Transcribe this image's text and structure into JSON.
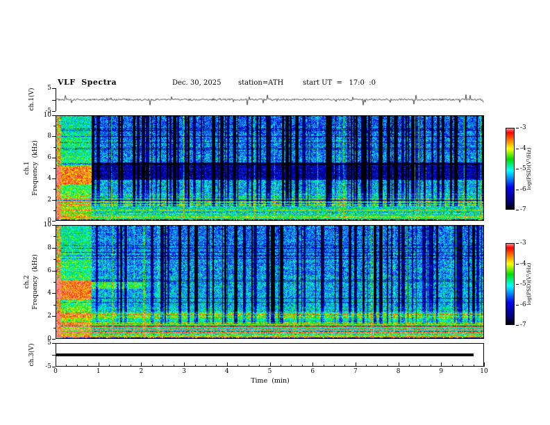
{
  "page": {
    "background": "#ffffff"
  },
  "header": {
    "title": "VLF  Spectra",
    "date": "Dec. 30, 2025",
    "station": "station=ATH",
    "start_ut": "start UT  =   17:0  :0"
  },
  "axes": {
    "time_label": "Time  (min)",
    "time_ticks": [
      0,
      1,
      2,
      3,
      4,
      5,
      6,
      7,
      8,
      9,
      10
    ],
    "freq_ticks": [
      0,
      2,
      4,
      6,
      8,
      10
    ],
    "freq_minor_ticks": [
      1,
      3,
      5,
      7,
      9
    ],
    "volt_ticks": [
      5,
      0,
      -5
    ],
    "volt_labeled": [
      5,
      -5
    ]
  },
  "panels": {
    "ch1_wave": {
      "ylabel": "ch.1(V)",
      "ymin": -5,
      "ymax": 5
    },
    "ch1_spec": {
      "ylabel_channel": "ch.1",
      "ylabel_axis": "Frequency  (kHz)"
    },
    "ch2_spec": {
      "ylabel_channel": "ch.2",
      "ylabel_axis": "Frequency  (kHz)"
    },
    "ch3_wave": {
      "ylabel": "ch.3(V)",
      "ymin": -5,
      "ymax": 5
    }
  },
  "colorbar": {
    "label": "log(PSD)(V²/Hz)",
    "ticks": [
      "-3",
      "-4",
      "-5",
      "-6",
      "-7"
    ],
    "gradient_stops": [
      [
        0.0,
        "#000000"
      ],
      [
        0.09,
        "#000070"
      ],
      [
        0.27,
        "#0000ee"
      ],
      [
        0.48,
        "#00ffff"
      ],
      [
        0.62,
        "#00dd00"
      ],
      [
        0.75,
        "#ffff00"
      ],
      [
        0.87,
        "#ff6600"
      ],
      [
        0.95,
        "#ff0000"
      ],
      [
        1.0,
        "#ff8888"
      ]
    ]
  },
  "chart_data": [
    {
      "id": "ch1-waveform",
      "type": "line",
      "ylabel": "ch.1(V)",
      "xlim": [
        0,
        10
      ],
      "ylim": [
        -5,
        5
      ],
      "description": "Broadband noise trace centred on 0 V, typical excursions about ±0.5 V, with sparse impulsive spikes reaching roughly ±2.5 V throughout the 10-minute record",
      "gen": {
        "seed": 41,
        "noise": 0.4,
        "spike_prob": 0.055,
        "spike_max": 2.6
      }
    },
    {
      "id": "ch1-spectrogram",
      "type": "heatmap",
      "xlabel": "Time (min)",
      "ylabel": "ch.1 Frequency (kHz)",
      "zlabel": "log(PSD)(V²/Hz)",
      "xlim": [
        0,
        10
      ],
      "ylim": [
        0,
        10
      ],
      "zlim": [
        -7,
        -3
      ],
      "colormap": "jet-like: black(-7) -> blue -> cyan -> green -> yellow -> red(-3)",
      "features": [
        "first ~0.8 min: bright unbroken green/yellow broadband startup segment with yellow blob near 3.5-5 kHz",
        "after 0.8 min: dense dark navy vertical dropout streaks over cyan/green speckle background",
        "persistent darker horizontal band around 4-5.5 kHz",
        "strong yellow/orange/red horizontal harmonic lines below ~2.5 kHz",
        "nearly black band at the very bottom (<0.2 kHz) with red dots"
      ],
      "gen": {
        "seed": 7,
        "base": -5.15,
        "slope": 0.05,
        "noise": 1.3,
        "streak_start": 0.17,
        "streak_len": 5,
        "startup_t": 0.82,
        "startup_dv": 0.7,
        "bands": [
          {
            "f0": 3.4,
            "f1": 5.2,
            "t0": 0,
            "t1": 0.82,
            "dv": 1.1
          },
          {
            "f0": 3.9,
            "f1": 5.6,
            "t0": 0.82,
            "t1": 10,
            "dv": -0.9
          }
        ]
      }
    },
    {
      "id": "ch2-spectrogram",
      "type": "heatmap",
      "xlabel": "Time (min)",
      "ylabel": "ch.2 Frequency (kHz)",
      "zlabel": "log(PSD)(V²/Hz)",
      "xlim": [
        0,
        10
      ],
      "ylim": [
        0,
        10
      ],
      "zlim": [
        -7,
        -3
      ],
      "colormap": "jet-like: black(-7) -> blue -> cyan -> green -> yellow -> red(-3)",
      "features": [
        "first ~0.8 min: bright green/yellow broadband startup segment",
        "bright green/yellow band near 4.4-5 kHz persisting to about 2 min",
        "dense dark navy vertical dropout streaks after startup",
        "dense red/orange harmonic lines below ~2.5 kHz for entire record",
        "nearly black band at the very bottom (<0.2 kHz) with red dots"
      ],
      "gen": {
        "seed": 19,
        "base": -5.1,
        "slope": 0.05,
        "noise": 1.3,
        "streak_start": 0.17,
        "streak_len": 5,
        "startup_t": 0.82,
        "startup_dv": 0.7,
        "bands": [
          {
            "f0": 3.4,
            "f1": 5.2,
            "t0": 0,
            "t1": 0.82,
            "dv": 1.2
          },
          {
            "f0": 4.4,
            "f1": 5.0,
            "t0": 0.82,
            "t1": 2.0,
            "dv": 0.7
          },
          {
            "f0": 1.6,
            "f1": 2.4,
            "t0": 0,
            "t1": 10,
            "dv": 0.3
          }
        ]
      }
    },
    {
      "id": "ch3-waveform",
      "type": "line",
      "ylabel": "ch.3(V)",
      "xlim": [
        0,
        10
      ],
      "ylim": [
        -5,
        5
      ],
      "description": "Flat thick black trace at exactly 0 V for the whole record (inactive channel)",
      "gen": {
        "flat_value": 0,
        "x_end": 9.78,
        "thickness": 4
      }
    }
  ]
}
